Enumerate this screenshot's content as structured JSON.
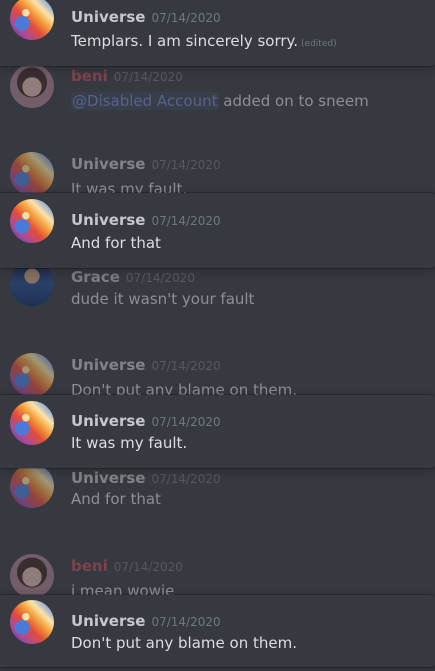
{
  "colors": {
    "background": "#36393f",
    "universe": "#c5c7cc",
    "beni": "#c24a57",
    "grace": "#b9bbbe"
  },
  "messages": [
    {
      "author": "Universe",
      "timestamp": "07/14/2020",
      "text": "Templars. I am sincerely sorry.",
      "edited": "(edited)",
      "avatar": "universe-avatar",
      "state": "active"
    },
    {
      "author": "beni",
      "timestamp": "07/14/2020",
      "mention": "@Disabled Account",
      "text": " added on to sneem",
      "avatar": "beni-avatar",
      "state": "faded"
    },
    {
      "author": "Universe",
      "timestamp": "07/14/2020",
      "text": "It was my fault.",
      "avatar": "universe-avatar",
      "state": "faded"
    },
    {
      "author": "Universe",
      "timestamp": "07/14/2020",
      "text": "And for that",
      "avatar": "universe-avatar",
      "state": "active"
    },
    {
      "author": "Grace",
      "timestamp": "07/14/2020",
      "text": "dude it wasn't your fault",
      "avatar": "grace-avatar",
      "state": "faded"
    },
    {
      "author": "Universe",
      "timestamp": "07/14/2020",
      "text": "Don't put any blame on them.",
      "avatar": "universe-avatar",
      "state": "faded"
    },
    {
      "author": "Universe",
      "timestamp": "07/14/2020",
      "text": "It was my fault.",
      "avatar": "universe-avatar",
      "state": "active"
    },
    {
      "author": "Universe",
      "timestamp": "07/14/2020",
      "text": "And for that",
      "avatar": "universe-avatar",
      "state": "faded"
    },
    {
      "author": "beni",
      "timestamp": "07/14/2020",
      "text": "i mean wowie",
      "avatar": "beni-avatar",
      "state": "faded"
    },
    {
      "author": "Universe",
      "timestamp": "07/14/2020",
      "text": "Don't put any blame on them.",
      "avatar": "universe-avatar",
      "state": "active"
    }
  ]
}
